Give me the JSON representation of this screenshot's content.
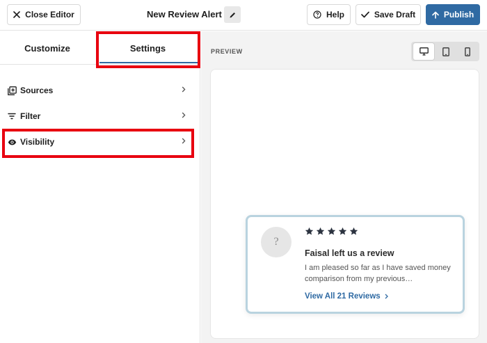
{
  "header": {
    "close_label": "Close Editor",
    "title": "New Review Alert",
    "help_label": "Help",
    "save_draft_label": "Save Draft",
    "publish_label": "Publish"
  },
  "sidebar": {
    "tabs": [
      {
        "label": "Customize",
        "active": false
      },
      {
        "label": "Settings",
        "active": true
      }
    ],
    "items": [
      {
        "label": "Sources",
        "icon": "add-box-icon"
      },
      {
        "label": "Filter",
        "icon": "filter-icon"
      },
      {
        "label": "Visibility",
        "icon": "eye-icon",
        "highlighted": true
      }
    ]
  },
  "preview": {
    "label": "PREVIEW",
    "devices": [
      {
        "name": "desktop",
        "icon": "desktop-icon",
        "selected": true
      },
      {
        "name": "tablet",
        "icon": "tablet-icon",
        "selected": false
      },
      {
        "name": "mobile",
        "icon": "mobile-icon",
        "selected": false
      }
    ],
    "notification": {
      "avatar_glyph": "?",
      "rating": 5,
      "max_rating": 5,
      "title": "Faisal left us a review",
      "body": "I am pleased so far as I have saved money comparison from my previous…",
      "link_label": "View All 21 Reviews"
    }
  },
  "colors": {
    "accent": "#2f6aa3",
    "highlight": "#e8000f",
    "card_border": "#b9d3df",
    "star": "#2c3340"
  }
}
